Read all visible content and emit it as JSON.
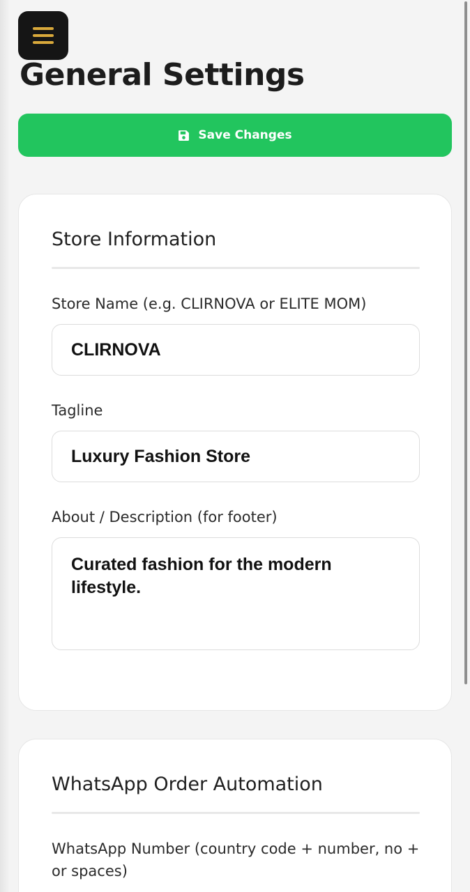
{
  "header": {
    "menu_icon": "hamburger-menu-icon",
    "title": "General Settings"
  },
  "toolbar": {
    "save_label": "Save Changes",
    "save_icon": "floppy-disk-icon"
  },
  "store_info": {
    "title": "Store Information",
    "store_name": {
      "label": "Store Name (e.g. CLIRNOVA or ELITE MOM)",
      "value": "CLIRNOVA"
    },
    "tagline": {
      "label": "Tagline",
      "value": "Luxury Fashion Store"
    },
    "about": {
      "label": "About / Description (for footer)",
      "value": "Curated fashion for the modern lifestyle."
    }
  },
  "whatsapp": {
    "title": "WhatsApp Order Automation",
    "number": {
      "label": "WhatsApp Number (country code + number, no + or spaces)"
    }
  },
  "colors": {
    "accent": "#22c55e",
    "menu_bg": "#151515",
    "menu_icon": "#d9a93b"
  }
}
